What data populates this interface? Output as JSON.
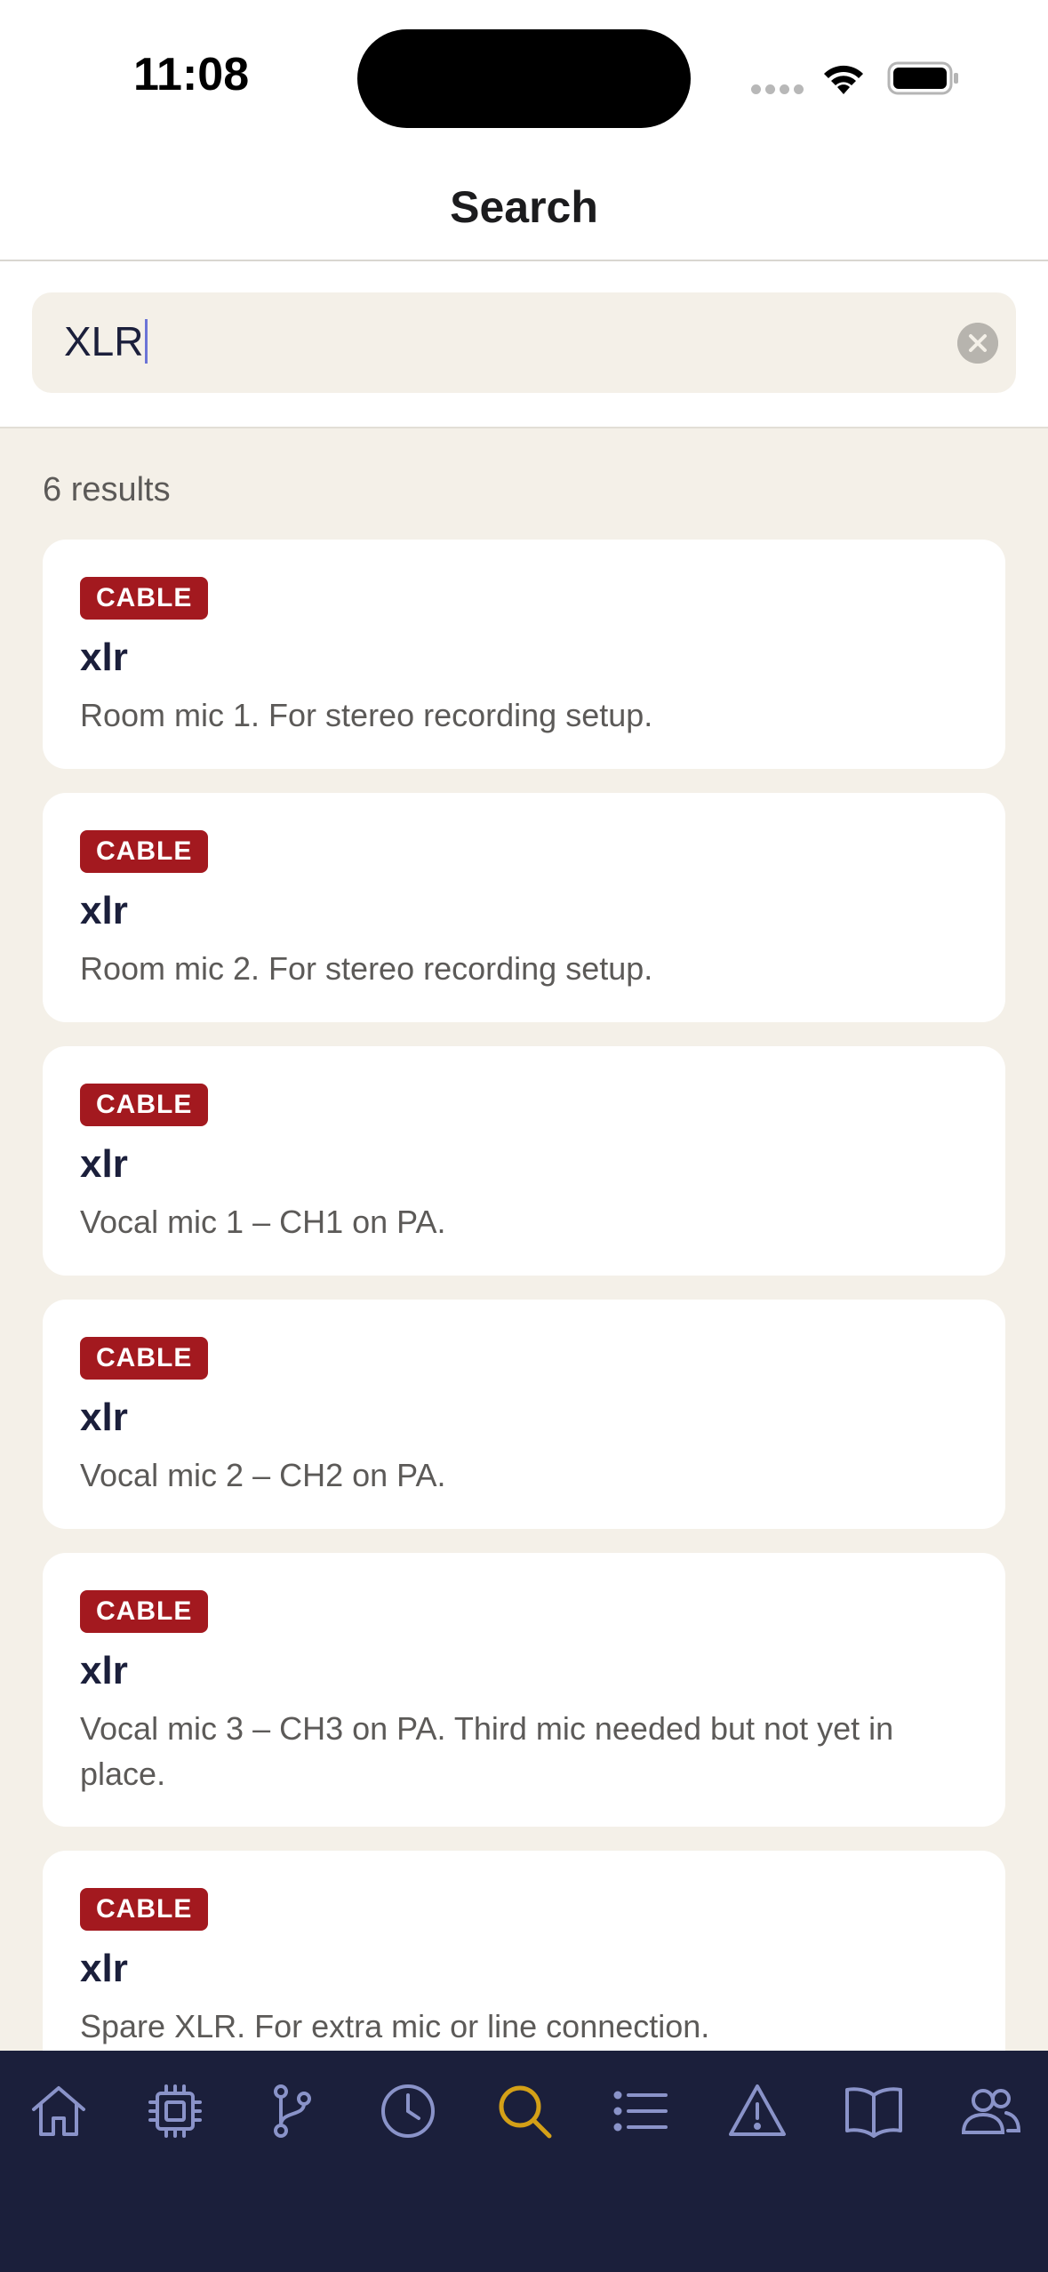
{
  "status_bar": {
    "time": "11:08"
  },
  "header": {
    "title": "Search"
  },
  "search": {
    "value": "XLR"
  },
  "results": {
    "count_label": "6 results",
    "items": [
      {
        "badge": "CABLE",
        "title": "xlr",
        "description": "Room mic 1. For stereo recording setup."
      },
      {
        "badge": "CABLE",
        "title": "xlr",
        "description": "Room mic 2. For stereo recording setup."
      },
      {
        "badge": "CABLE",
        "title": "xlr",
        "description": "Vocal mic 1 – CH1 on PA."
      },
      {
        "badge": "CABLE",
        "title": "xlr",
        "description": "Vocal mic 2 – CH2 on PA."
      },
      {
        "badge": "CABLE",
        "title": "xlr",
        "description": "Vocal mic 3 – CH3 on PA. Third mic needed but not yet in place."
      },
      {
        "badge": "CABLE",
        "title": "xlr",
        "description": "Spare XLR. For extra mic or line connection."
      }
    ]
  },
  "tab_bar": {
    "active_color": "#d4a017",
    "inactive_color": "#8a93c9",
    "tabs": [
      {
        "icon": "home-icon",
        "active": false
      },
      {
        "icon": "chip-icon",
        "active": false
      },
      {
        "icon": "branch-icon",
        "active": false
      },
      {
        "icon": "clock-icon",
        "active": false
      },
      {
        "icon": "search-icon",
        "active": true
      },
      {
        "icon": "list-icon",
        "active": false
      },
      {
        "icon": "warning-icon",
        "active": false
      },
      {
        "icon": "book-icon",
        "active": false
      },
      {
        "icon": "users-icon",
        "active": false
      }
    ]
  },
  "colors": {
    "badge": "#a3191f",
    "background": "#f4f0e8",
    "navy": "#1b1f3b"
  }
}
